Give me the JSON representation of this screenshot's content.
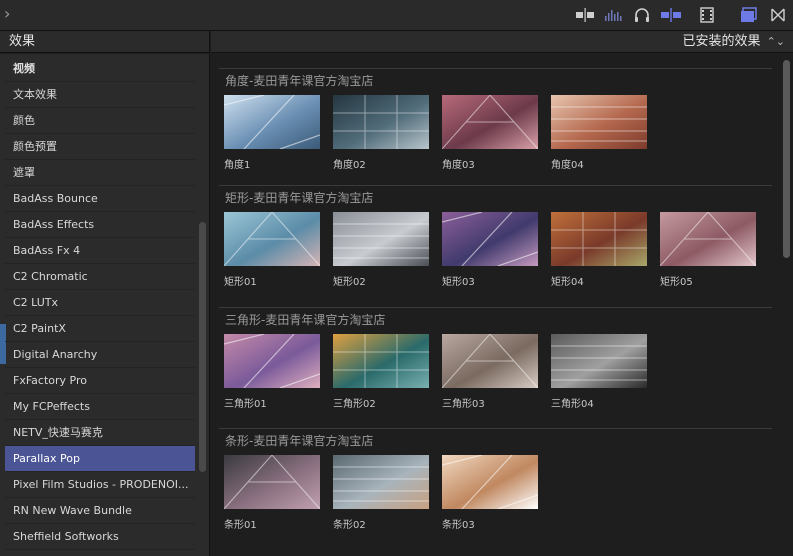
{
  "toolbar": {
    "expand_icon": "chevron-right",
    "icons": [
      "clip-skimming-icon",
      "audio-waveform-icon",
      "headphones-icon",
      "snapping-icon",
      "filmstrip-icon",
      "browser-toggle-icon",
      "transitions-icon"
    ],
    "accent": "#6e7ae6"
  },
  "header": {
    "left_title": "效果",
    "right_filter": "已安装的效果"
  },
  "sidebar": {
    "items": [
      {
        "label": "视频",
        "type": "heading"
      },
      {
        "label": "文本效果"
      },
      {
        "label": "颜色"
      },
      {
        "label": "颜色预置"
      },
      {
        "label": "遮罩"
      },
      {
        "label": "BadAss Bounce"
      },
      {
        "label": "BadAss Effects"
      },
      {
        "label": "BadAss Fx 4"
      },
      {
        "label": "C2 Chromatic"
      },
      {
        "label": "C2 LUTx"
      },
      {
        "label": "C2 PaintX"
      },
      {
        "label": "Digital Anarchy"
      },
      {
        "label": "FxFactory Pro"
      },
      {
        "label": "My FCPeffects"
      },
      {
        "label": "NETV_快速马赛克"
      },
      {
        "label": "Parallax Pop",
        "selected": true
      },
      {
        "label": "Pixel Film Studios - PRODENOI..."
      },
      {
        "label": "RN New Wave Bundle"
      },
      {
        "label": "Sheffield Softworks"
      }
    ],
    "selected_color": "#4b5596"
  },
  "sections": [
    {
      "title": "角度-麦田青年课官方淘宝店",
      "items": [
        "角度1",
        "角度02",
        "角度03",
        "角度04"
      ]
    },
    {
      "title": "矩形-麦田青年课官方淘宝店",
      "items": [
        "矩形01",
        "矩形02",
        "矩形03",
        "矩形04",
        "矩形05"
      ]
    },
    {
      "title": "三角形-麦田青年课官方淘宝店",
      "items": [
        "三角形01",
        "三角形02",
        "三角形03",
        "三角形04"
      ]
    },
    {
      "title": "条形-麦田青年课官方淘宝店",
      "items": [
        "条形01",
        "条形02",
        "条形03"
      ]
    }
  ]
}
